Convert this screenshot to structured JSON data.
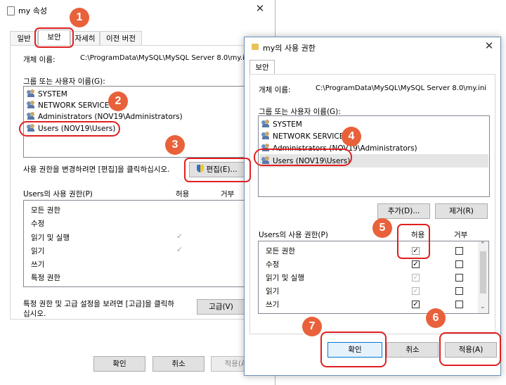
{
  "colors": {
    "accent": "#0078d7",
    "highlight": "#e02020",
    "badge": "#e8613a"
  },
  "back": {
    "title": "my 속성",
    "tabs": [
      "일반",
      "보안",
      "자세히",
      "이전 버전"
    ],
    "object_label": "개체 이름:",
    "object_value": "C:\\ProgramData\\MySQL\\MySQL Server 8.0\\my.ini",
    "group_label": "그룹 또는 사용자 이름(G):",
    "users": [
      "SYSTEM",
      "NETWORK SERVICE",
      "Administrators (NOV19\\Administrators)",
      "Users (NOV19\\Users)"
    ],
    "change_text": "사용 권한을 변경하려면 [편집]을 클릭하십시오.",
    "edit_button": "편집(E)...",
    "perm_label": "Users의 사용 권한(P)",
    "allow_header": "허용",
    "deny_header": "거부",
    "perms": [
      {
        "name": "모든 권한",
        "allow": false
      },
      {
        "name": "수정",
        "allow": false
      },
      {
        "name": "읽기 및 실행",
        "allow": true
      },
      {
        "name": "읽기",
        "allow": true
      },
      {
        "name": "쓰기",
        "allow": false
      },
      {
        "name": "특정 권한",
        "allow": false
      }
    ],
    "adv_text_line1": "특정 권한 및 고급 설정을 보려면 [고급]을 클릭하",
    "adv_text_line2": "십시오.",
    "advanced_button": "고급(V)",
    "ok_button": "확인",
    "cancel_button": "취소",
    "apply_button": "적용(A)"
  },
  "front": {
    "title": "my의 사용 권한",
    "tab": "보안",
    "object_label": "개체 이름:",
    "object_value": "C:\\ProgramData\\MySQL\\MySQL Server 8.0\\my.ini",
    "group_label": "그룹 또는 사용자 이름(G):",
    "users": [
      "SYSTEM",
      "NETWORK SERVICE",
      "Administrators (NOV19\\Administrators)",
      "Users (NOV19\\Users)"
    ],
    "add_button": "추가(D)...",
    "remove_button": "제거(R)",
    "perm_label": "Users의 사용 권한(P)",
    "allow_header": "허용",
    "deny_header": "거부",
    "perms": [
      {
        "name": "모든 권한",
        "allow": true,
        "allow_disabled": false,
        "deny": false
      },
      {
        "name": "수정",
        "allow": true,
        "allow_disabled": false,
        "deny": false
      },
      {
        "name": "읽기 및 실행",
        "allow": true,
        "allow_disabled": true,
        "deny": false
      },
      {
        "name": "읽기",
        "allow": true,
        "allow_disabled": true,
        "deny": false
      },
      {
        "name": "쓰기",
        "allow": true,
        "allow_disabled": false,
        "deny": false
      }
    ],
    "ok_button": "확인",
    "cancel_button": "취소",
    "apply_button": "적용(A)"
  },
  "steps": [
    "1",
    "2",
    "3",
    "4",
    "5",
    "6",
    "7"
  ]
}
